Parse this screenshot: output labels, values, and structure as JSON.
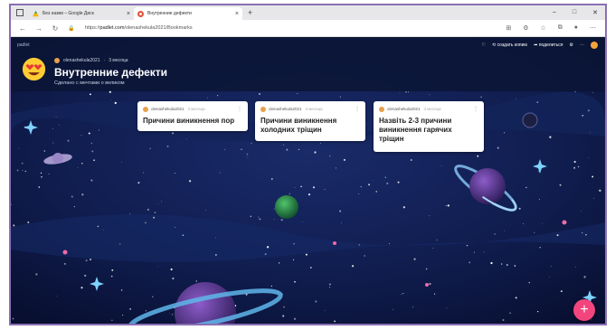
{
  "browser": {
    "tabs": [
      {
        "title": "Без назви – Google Диск",
        "favicon_color": "#f4b400",
        "active": false
      },
      {
        "title": "Внутренние дефекти",
        "favicon_color": "#e0533a",
        "active": true
      }
    ],
    "new_tab_label": "+",
    "url_host": "padlet.com",
    "url_prefix": "https://",
    "url_path": "/olenashekula2021/Bookmarks",
    "window_controls": {
      "minimize": "–",
      "maximize": "□",
      "close": "✕"
    }
  },
  "padlet": {
    "brand": "padlet",
    "actions": {
      "remake": "создать копию",
      "share": "поделиться"
    },
    "author": "olenashekula2021",
    "time_ago": "3 месяца",
    "title": "Внутренние дефекти",
    "subtitle": "Сделано с мечтами о великом",
    "cards": [
      {
        "author": "olenashekula2021",
        "time": "3 месяца",
        "text": "Причини виникнення пор"
      },
      {
        "author": "olenashekula2021",
        "time": "3 месяца",
        "text": "Причини виникнення холодних тріщин"
      },
      {
        "author": "olenashekula2021",
        "time": "3 месяца",
        "text": "Назвіть 2-3 причини виникнення гарячих тріщин"
      }
    ],
    "fab_label": "+"
  },
  "colors": {
    "background": "#0a1233",
    "fab": "#f2457e",
    "accent_orange": "#f3a43a"
  }
}
